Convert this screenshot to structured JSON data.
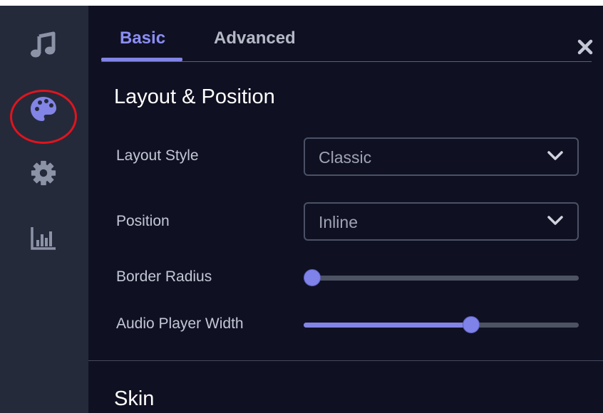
{
  "tabs": [
    {
      "label": "Basic",
      "active": true
    },
    {
      "label": "Advanced",
      "active": false
    }
  ],
  "sidebar": {
    "items": [
      {
        "icon": "music-note-icon",
        "active": false
      },
      {
        "icon": "palette-icon",
        "active": true
      },
      {
        "icon": "gear-icon",
        "active": false
      },
      {
        "icon": "bar-chart-icon",
        "active": false
      }
    ]
  },
  "close_icon": "close-icon",
  "sections": {
    "layout": {
      "title": "Layout & Position",
      "layout_style": {
        "label": "Layout Style",
        "value": "Classic"
      },
      "position": {
        "label": "Position",
        "value": "Inline"
      },
      "border_radius": {
        "label": "Border Radius",
        "value_fraction": 0.0
      },
      "audio_player_width": {
        "label": "Audio Player Width",
        "value_fraction": 0.61
      }
    },
    "skin": {
      "title": "Skin"
    }
  },
  "colors": {
    "accent": "#8284e6",
    "sidebar_bg": "#242a3a",
    "main_bg": "#0f1122",
    "highlight": "#e0141e"
  }
}
